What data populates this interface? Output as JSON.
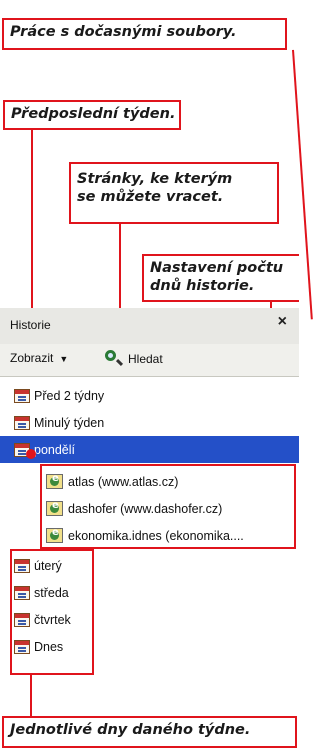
{
  "callouts": {
    "temp_files": "Práce s dočasnými soubory.",
    "previous_week": "Předposlední týden.",
    "revisit_pages_line1": "Stránky, ke kterým",
    "revisit_pages_line2": "se můžete vracet.",
    "history_days_line1": "Nastavení počtu",
    "history_days_line2": "dnů historie.",
    "days_of_week": "Jednotlivé dny daného týdne."
  },
  "panel": {
    "title": "Historie",
    "close_symbol": "×",
    "toolbar": {
      "view_label": "Zobrazit",
      "view_caret": "▼",
      "search_label": "Hledat"
    },
    "tree": [
      {
        "label": "Před 2 týdny",
        "icon": "calendar-icon",
        "selected": false
      },
      {
        "label": "Minulý týden",
        "icon": "calendar-icon",
        "selected": false
      },
      {
        "label": "pondělí",
        "icon": "calendar-icon",
        "selected": true
      },
      {
        "label": "atlas (www.atlas.cz)",
        "icon": "site-folder-icon",
        "selected": false
      },
      {
        "label": "dashofer (www.dashofer.cz)",
        "icon": "site-folder-icon",
        "selected": false
      },
      {
        "label": "ekonomika.idnes (ekonomika....",
        "icon": "site-folder-icon",
        "selected": false
      },
      {
        "label": "úterý",
        "icon": "calendar-icon",
        "selected": false
      },
      {
        "label": "středa",
        "icon": "calendar-icon",
        "selected": false
      },
      {
        "label": "čtvrtek",
        "icon": "calendar-icon",
        "selected": false
      },
      {
        "label": "Dnes",
        "icon": "calendar-icon",
        "selected": false
      }
    ]
  },
  "colors": {
    "callout_border": "#e0141c",
    "selection": "#2450c8"
  }
}
